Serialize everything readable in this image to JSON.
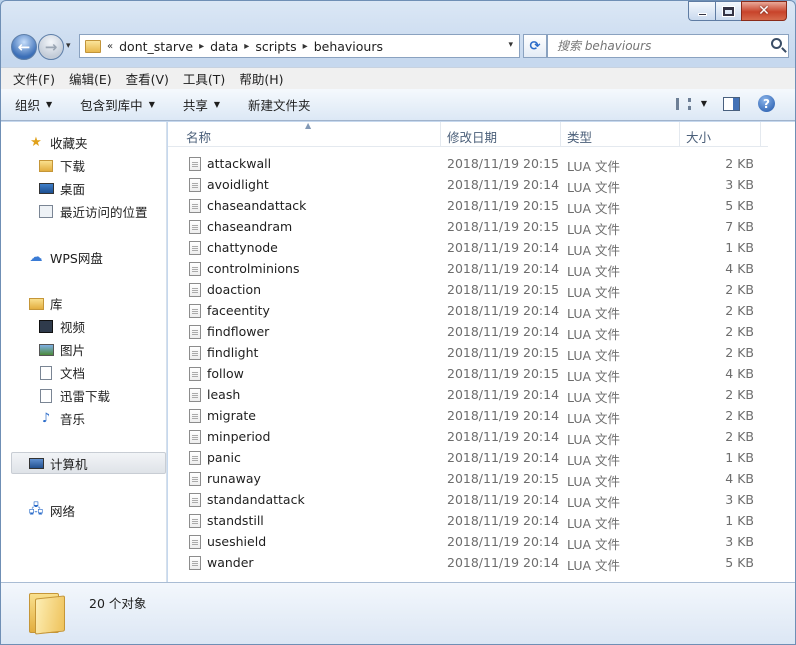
{
  "caption": {
    "close_glyph": "✕"
  },
  "nav": {
    "back_glyph": "←",
    "forward_glyph": "→",
    "history_glyph": "▾",
    "breadcrumb_overflow": "«",
    "breadcrumbs": [
      "dont_starve",
      "data",
      "scripts",
      "behaviours"
    ],
    "sep_glyph": "▸",
    "dropdown_glyph": "▾",
    "refresh_glyph": "⟳",
    "search_placeholder": "搜索 behaviours"
  },
  "menubar": {
    "items": [
      "文件(F)",
      "编辑(E)",
      "查看(V)",
      "工具(T)",
      "帮助(H)"
    ]
  },
  "commandbar": {
    "organize": "组织",
    "include_library": "包含到库中",
    "share": "共享",
    "new_folder": "新建文件夹",
    "caret": "▼",
    "help": "?"
  },
  "sidebar": {
    "favorites": {
      "label": "收藏夹",
      "icon": "star-icon",
      "items": [
        {
          "label": "下载",
          "icon": "download-folder-icon"
        },
        {
          "label": "桌面",
          "icon": "desktop-icon"
        },
        {
          "label": "最近访问的位置",
          "icon": "recent-places-icon"
        }
      ]
    },
    "wps": {
      "label": "WPS网盘",
      "icon": "cloud-icon"
    },
    "libraries": {
      "label": "库",
      "icon": "library-icon",
      "items": [
        {
          "label": "视频",
          "icon": "video-icon"
        },
        {
          "label": "图片",
          "icon": "picture-icon"
        },
        {
          "label": "文档",
          "icon": "document-icon"
        },
        {
          "label": "迅雷下载",
          "icon": "thunder-download-icon"
        },
        {
          "label": "音乐",
          "icon": "music-icon"
        }
      ]
    },
    "computer": {
      "label": "计算机",
      "icon": "computer-icon"
    },
    "network": {
      "label": "网络",
      "icon": "network-icon"
    }
  },
  "columns": {
    "name": "名称",
    "date": "修改日期",
    "type": "类型",
    "size": "大小"
  },
  "files": [
    {
      "name": "attackwall",
      "date": "2018/11/19 20:15",
      "type": "LUA 文件",
      "size": "2 KB"
    },
    {
      "name": "avoidlight",
      "date": "2018/11/19 20:14",
      "type": "LUA 文件",
      "size": "3 KB"
    },
    {
      "name": "chaseandattack",
      "date": "2018/11/19 20:15",
      "type": "LUA 文件",
      "size": "5 KB"
    },
    {
      "name": "chaseandram",
      "date": "2018/11/19 20:15",
      "type": "LUA 文件",
      "size": "7 KB"
    },
    {
      "name": "chattynode",
      "date": "2018/11/19 20:14",
      "type": "LUA 文件",
      "size": "1 KB"
    },
    {
      "name": "controlminions",
      "date": "2018/11/19 20:14",
      "type": "LUA 文件",
      "size": "4 KB"
    },
    {
      "name": "doaction",
      "date": "2018/11/19 20:15",
      "type": "LUA 文件",
      "size": "2 KB"
    },
    {
      "name": "faceentity",
      "date": "2018/11/19 20:14",
      "type": "LUA 文件",
      "size": "2 KB"
    },
    {
      "name": "findflower",
      "date": "2018/11/19 20:14",
      "type": "LUA 文件",
      "size": "2 KB"
    },
    {
      "name": "findlight",
      "date": "2018/11/19 20:15",
      "type": "LUA 文件",
      "size": "2 KB"
    },
    {
      "name": "follow",
      "date": "2018/11/19 20:15",
      "type": "LUA 文件",
      "size": "4 KB"
    },
    {
      "name": "leash",
      "date": "2018/11/19 20:14",
      "type": "LUA 文件",
      "size": "2 KB"
    },
    {
      "name": "migrate",
      "date": "2018/11/19 20:14",
      "type": "LUA 文件",
      "size": "2 KB"
    },
    {
      "name": "minperiod",
      "date": "2018/11/19 20:14",
      "type": "LUA 文件",
      "size": "2 KB"
    },
    {
      "name": "panic",
      "date": "2018/11/19 20:14",
      "type": "LUA 文件",
      "size": "1 KB"
    },
    {
      "name": "runaway",
      "date": "2018/11/19 20:15",
      "type": "LUA 文件",
      "size": "4 KB"
    },
    {
      "name": "standandattack",
      "date": "2018/11/19 20:14",
      "type": "LUA 文件",
      "size": "3 KB"
    },
    {
      "name": "standstill",
      "date": "2018/11/19 20:14",
      "type": "LUA 文件",
      "size": "1 KB"
    },
    {
      "name": "useshield",
      "date": "2018/11/19 20:14",
      "type": "LUA 文件",
      "size": "3 KB"
    },
    {
      "name": "wander",
      "date": "2018/11/19 20:14",
      "type": "LUA 文件",
      "size": "5 KB"
    }
  ],
  "details": {
    "count": "20 个对象"
  }
}
